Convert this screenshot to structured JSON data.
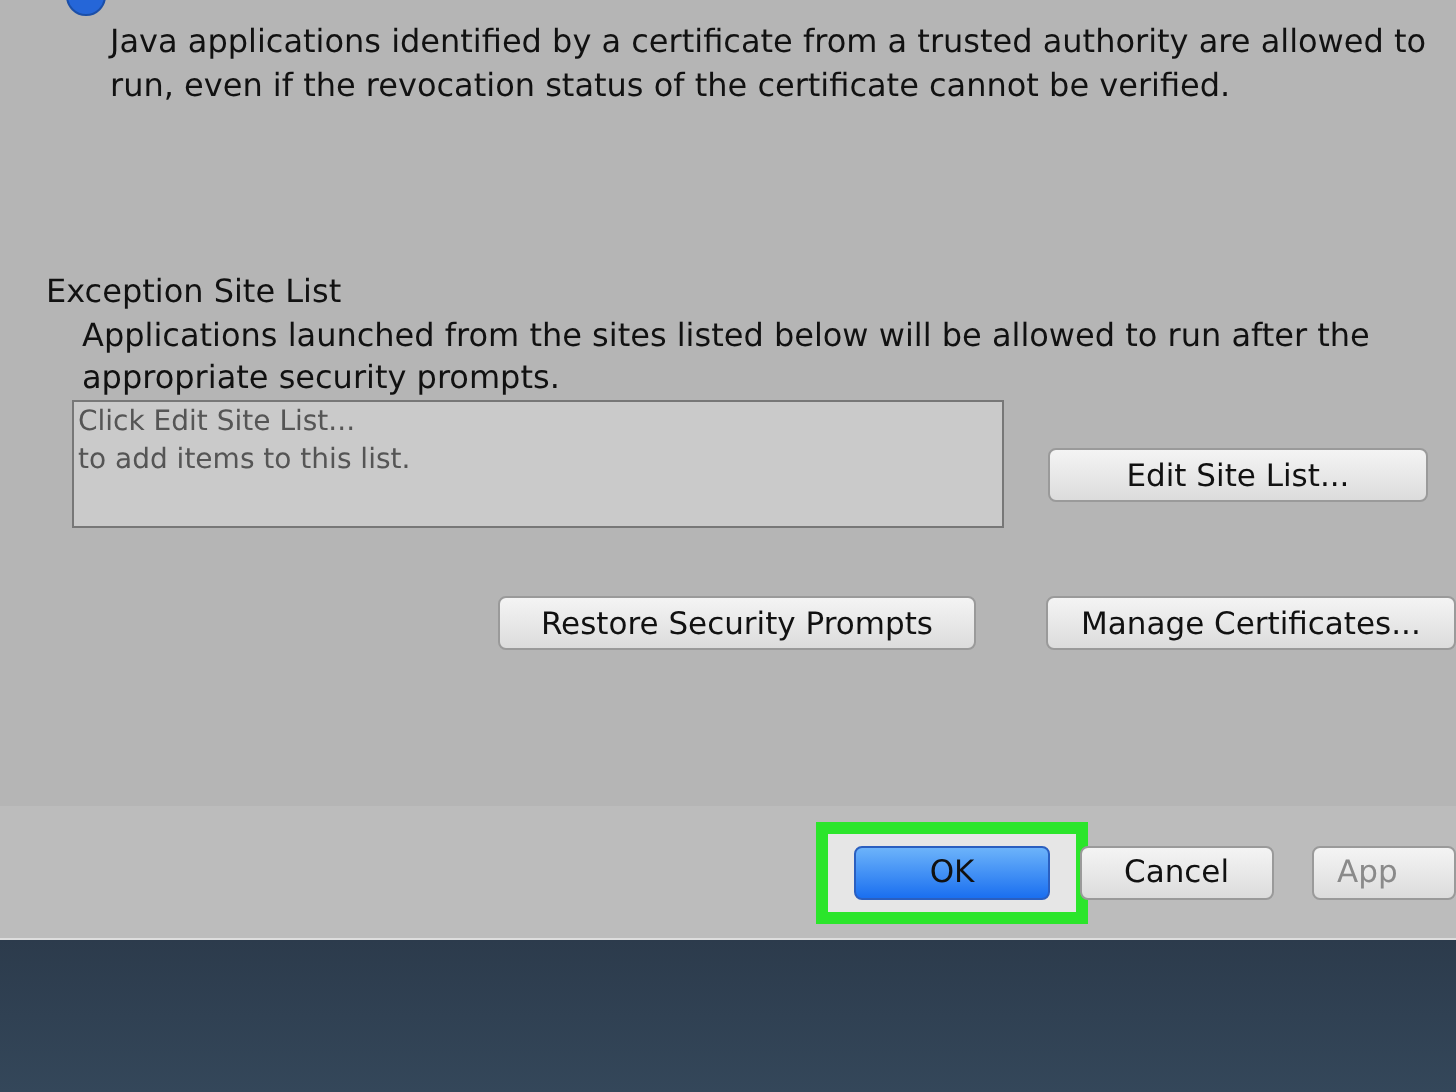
{
  "security_level": {
    "selected": true,
    "description": "Java applications identified by a certificate from a trusted authority are allowed to run, even if the revocation status of the certificate cannot be verified."
  },
  "exception_site_list": {
    "title": "Exception Site List",
    "description": "Applications launched from the sites listed below will be allowed to run after the appropriate security prompts.",
    "list_hint": [
      "Click Edit Site List...",
      "to add items to this list."
    ],
    "edit_button": "Edit Site List..."
  },
  "buttons": [
    {
      "label": "Restore Security Prompts"
    },
    {
      "label": "Manage Certificates..."
    }
  ],
  "footer_buttons": [
    {
      "label": "OK",
      "kind": "default",
      "disabled": false,
      "highlighted": true
    },
    {
      "label": "Cancel",
      "kind": "normal",
      "disabled": false,
      "highlighted": false
    },
    {
      "label": "App",
      "kind": "normal",
      "disabled": true,
      "highlighted": false
    }
  ]
}
